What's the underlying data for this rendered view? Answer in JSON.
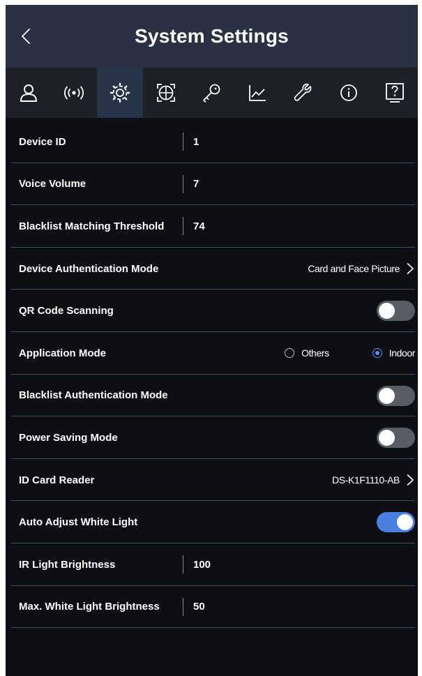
{
  "header": {
    "title": "System Settings",
    "back_icon": "chevron-left-icon"
  },
  "tabs": [
    {
      "icon": "user-icon",
      "active": false
    },
    {
      "icon": "wireless-icon",
      "active": false
    },
    {
      "icon": "gear-icon",
      "active": true
    },
    {
      "icon": "face-scan-icon",
      "active": false
    },
    {
      "icon": "key-icon",
      "active": false
    },
    {
      "icon": "chart-icon",
      "active": false
    },
    {
      "icon": "wrench-icon",
      "active": false
    },
    {
      "icon": "info-icon",
      "active": false
    },
    {
      "icon": "help-icon",
      "active": false
    }
  ],
  "settings": {
    "device_id": {
      "label": "Device ID",
      "value": "1"
    },
    "voice_volume": {
      "label": "Voice Volume",
      "value": "7"
    },
    "blacklist_threshold": {
      "label": "Blacklist Matching Threshold",
      "value": "74"
    },
    "auth_mode": {
      "label": "Device Authentication Mode",
      "value": "Card and Face Picture"
    },
    "qr_scanning": {
      "label": "QR Code Scanning",
      "enabled": false
    },
    "application_mode": {
      "label": "Application Mode",
      "options": [
        "Others",
        "Indoor"
      ],
      "selected": "Indoor"
    },
    "blacklist_auth_mode": {
      "label": "Blacklist Authentication Mode",
      "enabled": false
    },
    "power_saving": {
      "label": "Power Saving Mode",
      "enabled": false
    },
    "id_card_reader": {
      "label": "ID Card Reader",
      "value": "DS-K1F1110-AB"
    },
    "auto_white_light": {
      "label": "Auto Adjust White Light",
      "enabled": true
    },
    "ir_brightness": {
      "label": "IR Light Brightness",
      "value": "100"
    },
    "max_white_brightness": {
      "label": "Max. White Light Brightness",
      "value": "50"
    }
  },
  "colors": {
    "header_bg": "#2a3142",
    "tab_bg": "#1d2027",
    "tab_active_bg": "#263448",
    "page_bg": "#0e0f15",
    "accent": "#4a7fe2"
  }
}
